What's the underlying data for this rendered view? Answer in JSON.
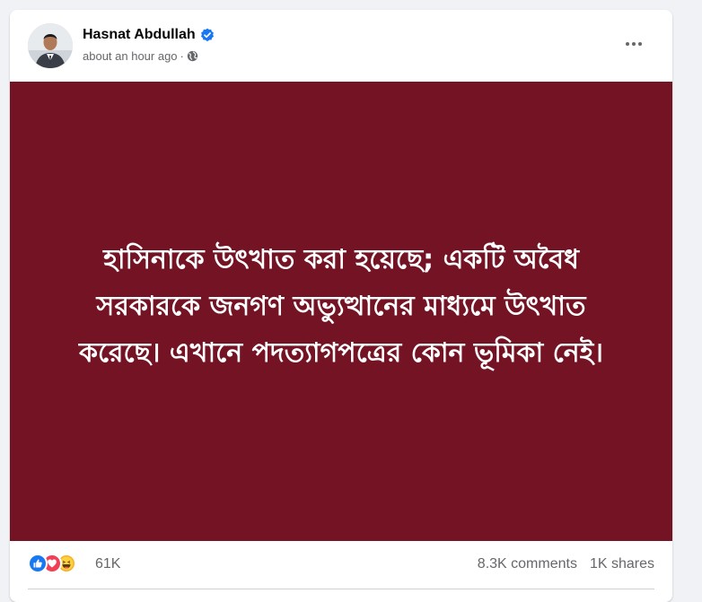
{
  "post": {
    "author": "Hasnat Abdullah",
    "time": "about an hour ago",
    "separator": "·",
    "text": "হাসিনাকে উৎখাত করা হয়েছে; একটি অবৈধ সরকারকে জনগণ অভ্যুত্থানের মাধ্যমে উৎখাত করেছে। এখানে পদত্যাগপত্রের কোন ভূমিকা নেই।",
    "background_color": "#731324",
    "icons": {
      "verified": "verified-badge-icon",
      "audience": "globe-icon",
      "more": "more-options-icon"
    }
  },
  "engagement": {
    "reactions": [
      "like",
      "love",
      "haha"
    ],
    "reaction_count": "61K",
    "comments": "8.3K comments",
    "shares": "1K shares"
  },
  "colors": {
    "like": "#1877f2",
    "love": "#f33e58",
    "haha": "#f7b125",
    "verified": "#1877f2"
  }
}
